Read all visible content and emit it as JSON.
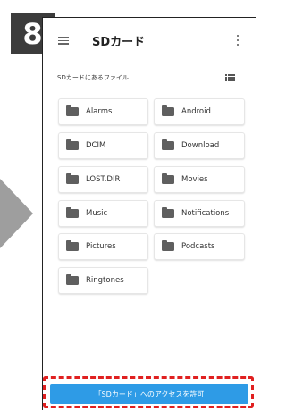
{
  "step": {
    "number": "8"
  },
  "appbar": {
    "title": "SDカード",
    "menu_icon": "hamburger-menu-icon",
    "more_icon": "more-vertical-icon"
  },
  "section": {
    "label": "SDカードにあるファイル",
    "view_icon": "list-view-icon"
  },
  "folders": [
    {
      "label": "Alarms"
    },
    {
      "label": "Android"
    },
    {
      "label": "DCIM"
    },
    {
      "label": "Download"
    },
    {
      "label": "LOST.DIR"
    },
    {
      "label": "Movies"
    },
    {
      "label": "Music"
    },
    {
      "label": "Notifications"
    },
    {
      "label": "Pictures"
    },
    {
      "label": "Podcasts"
    },
    {
      "label": "Ringtones"
    }
  ],
  "footer": {
    "allow_label": "「SDカード」へのアクセスを許可"
  },
  "colors": {
    "button": "#2e9be6",
    "highlight": "#e02020",
    "badge": "#3c3c3c",
    "arrow": "#9e9e9e",
    "folder_icon": "#5f5f5f"
  }
}
